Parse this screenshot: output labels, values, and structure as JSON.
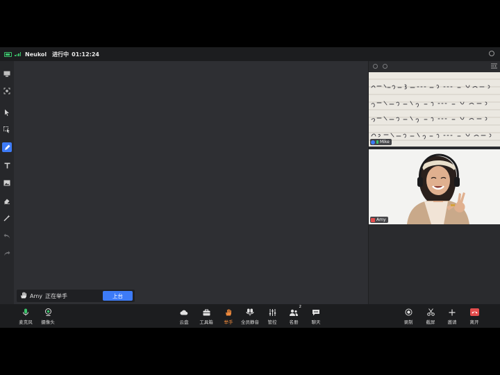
{
  "topbar": {
    "app_name": "Neukol",
    "status": "进行中",
    "timer": "01:12:24"
  },
  "left_tools": [
    {
      "name": "panel-icon"
    },
    {
      "name": "camera-frame-icon"
    },
    {
      "name": "pointer-icon"
    },
    {
      "name": "select-icon"
    },
    {
      "name": "pen-icon",
      "active": true
    },
    {
      "name": "text-icon"
    },
    {
      "name": "image-icon"
    },
    {
      "name": "eraser-icon"
    },
    {
      "name": "wand-icon"
    },
    {
      "name": "undo-icon"
    },
    {
      "name": "redo-icon"
    }
  ],
  "videos": [
    {
      "name": "Mike"
    },
    {
      "name": "Amy"
    }
  ],
  "hand_raise": {
    "name": "Amy",
    "message": "正在举手",
    "button": "上台"
  },
  "bottom_left": [
    {
      "label": "麦克风",
      "icon": "mic-icon"
    },
    {
      "label": "摄像头",
      "icon": "camera-icon"
    }
  ],
  "bottom_center": [
    {
      "label": "云盘",
      "icon": "cloud-icon"
    },
    {
      "label": "工具箱",
      "icon": "toolbox-icon"
    },
    {
      "label": "举手",
      "icon": "hand-icon",
      "active": true
    },
    {
      "label": "全员静音",
      "icon": "mute-all-icon"
    },
    {
      "label": "管控",
      "icon": "controls-icon"
    },
    {
      "label": "名册",
      "icon": "roster-icon",
      "badge": "2"
    },
    {
      "label": "聊天",
      "icon": "chat-icon"
    }
  ],
  "bottom_right": [
    {
      "label": "录制",
      "icon": "record-icon"
    },
    {
      "label": "截屏",
      "icon": "screenshot-icon"
    },
    {
      "label": "邀请",
      "icon": "invite-icon"
    },
    {
      "label": "离开",
      "icon": "hangup-icon"
    }
  ],
  "colors": {
    "accent": "#3d7bf7",
    "hand_active": "#f08a3c",
    "leave": "#e34d4d",
    "online": "#3bc46b"
  }
}
